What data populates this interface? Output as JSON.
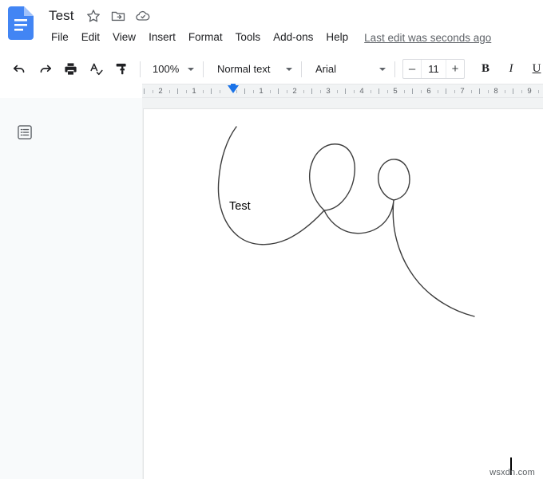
{
  "app": {
    "name": "Google Docs",
    "doc_icon_name": "google-docs-icon",
    "brand_color": "#4285f4",
    "accent_color": "#1a73e8"
  },
  "header": {
    "doc_title": "Test",
    "title_icons": [
      {
        "name": "star-icon",
        "label": "Star"
      },
      {
        "name": "move-to-folder-icon",
        "label": "Move"
      },
      {
        "name": "cloud-saved-icon",
        "label": "Saved to Drive"
      }
    ],
    "menus": [
      "File",
      "Edit",
      "View",
      "Insert",
      "Format",
      "Tools",
      "Add-ons",
      "Help"
    ],
    "last_edit": "Last edit was seconds ago"
  },
  "toolbar": {
    "buttons": [
      {
        "name": "undo-icon",
        "label": "Undo"
      },
      {
        "name": "redo-icon",
        "label": "Redo"
      },
      {
        "name": "print-icon",
        "label": "Print"
      },
      {
        "name": "spelling-check-icon",
        "label": "Spelling and grammar check"
      },
      {
        "name": "paint-format-icon",
        "label": "Paint format"
      }
    ],
    "zoom": "100%",
    "paragraph_style": "Normal text",
    "font_family": "Arial",
    "font_size": "11",
    "font_size_decrease": "–",
    "font_size_increase": "+",
    "bold": "B",
    "italic": "I",
    "underline": "U"
  },
  "ruler": {
    "left_numbers": [
      "2",
      "1"
    ],
    "right_numbers": [
      "1",
      "2",
      "3",
      "4",
      "5",
      "6",
      "7",
      "8",
      "9"
    ],
    "indent_marker_name": "left-indent-marker"
  },
  "sidebar": {
    "outline_button": {
      "name": "document-outline-icon",
      "label": "Show document outline"
    }
  },
  "document": {
    "text": "Test",
    "drawing": {
      "name": "freehand-scribble",
      "stroke_color": "#3c3c3c",
      "stroke_width": 1.4,
      "paths": [
        "M 116 22 C 104 38 96 62 94 88 C 91 120 101 146 119 160 C 136 173 160 172 180 163 C 199 154 214 140 226 127 C 210 112 204 88 210 69 C 215 53 228 42 243 44 C 258 46 266 62 264 80 C 262 104 246 126 226 127 C 232 140 243 150 256 154 C 270 158 286 155 297 146 C 307 138 312 126 313 114 C 300 110 292 96 294 82 C 296 70 305 62 315 63 C 326 64 333 75 333 88 C 333 102 325 112 313 114 C 311 134 313 155 320 175 C 329 201 345 222 364 236 C 380 248 398 256 414 260"
      ]
    },
    "caret_name": "text-cursor"
  },
  "watermark": {
    "text": "wsxdn.com"
  }
}
